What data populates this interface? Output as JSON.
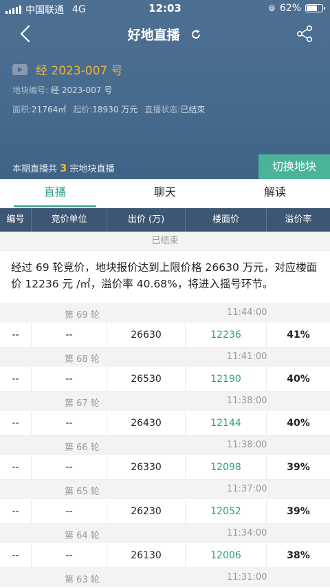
{
  "statusbar": {
    "carrier": "中国联通",
    "network": "4G",
    "time": "12:03",
    "battery": "62%"
  },
  "nav": {
    "title": "好地直播"
  },
  "lot": {
    "name": "经 2023-007 号",
    "id_label": "地块编号:",
    "id_value": "经 2023-007 号",
    "area_label": "面积:",
    "area_value": "21764㎡",
    "start_label": "起价:",
    "start_value": "18930 万元",
    "status_label": "直播状态:",
    "status_value": "已结束"
  },
  "period": {
    "prefix": "本期直播共",
    "count": "3",
    "suffix": "宗地块直播"
  },
  "switch_label": "切换地块",
  "tabs": [
    "直播",
    "聊天",
    "解读"
  ],
  "table_headers": [
    "编号",
    "竞价单位",
    "出价 (万)",
    "楼面价",
    "溢价率"
  ],
  "ended_label": "已结束",
  "summary": "经过 69 轮竞价，地块报价达到上限价格 26630 万元，对应楼面价 12236 元 /㎡，溢价率 40.68%，将进入摇号环节。",
  "rounds": [
    {
      "round": "第 69 轮",
      "time": "11:44:00",
      "no": "--",
      "bidder": "--",
      "bid": "26630",
      "floor": "12236",
      "premium": "41%"
    },
    {
      "round": "第 68 轮",
      "time": "11:41:00",
      "no": "--",
      "bidder": "--",
      "bid": "26530",
      "floor": "12190",
      "premium": "40%"
    },
    {
      "round": "第 67 轮",
      "time": "11:38:00",
      "no": "--",
      "bidder": "--",
      "bid": "26430",
      "floor": "12144",
      "premium": "40%"
    },
    {
      "round": "第 66 轮",
      "time": "11:38:00",
      "no": "--",
      "bidder": "--",
      "bid": "26330",
      "floor": "12098",
      "premium": "39%"
    },
    {
      "round": "第 65 轮",
      "time": "11:37:00",
      "no": "--",
      "bidder": "--",
      "bid": "26230",
      "floor": "12052",
      "premium": "39%"
    },
    {
      "round": "第 64 轮",
      "time": "11:34:00",
      "no": "--",
      "bidder": "--",
      "bid": "26130",
      "floor": "12006",
      "premium": "38%"
    },
    {
      "round": "第 63 轮",
      "time": "11:31:00"
    }
  ]
}
